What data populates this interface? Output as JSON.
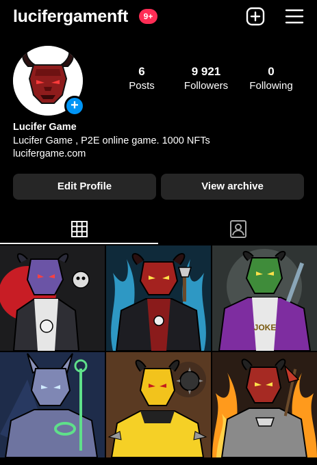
{
  "header": {
    "username": "lucifergamenft",
    "notification_badge": "9+",
    "add_icon": "plus-square-icon",
    "menu_icon": "hamburger-menu-icon"
  },
  "profile": {
    "avatar_icon": "add-story-plus-icon",
    "stats": [
      {
        "value": "6",
        "label": "Posts"
      },
      {
        "value": "9 921",
        "label": "Followers"
      },
      {
        "value": "0",
        "label": "Following"
      }
    ],
    "name": "Lucifer Game",
    "bio": "Lucifer Game , P2E online game. 1000 NFTs",
    "link": "lucifergame.com"
  },
  "actions": {
    "edit_profile": "Edit Profile",
    "view_archive": "View archive"
  },
  "tabs": [
    {
      "icon": "grid-icon",
      "active": true
    },
    {
      "icon": "tagged-person-icon",
      "active": false
    }
  ],
  "posts": [
    {
      "alt": "purple demon with skull"
    },
    {
      "alt": "red demon with blue flames and axe"
    },
    {
      "alt": "green demon in purple jacket"
    },
    {
      "alt": "blue armored demon"
    },
    {
      "alt": "yellow demon with spiked mace"
    },
    {
      "alt": "red demon with fire"
    }
  ],
  "colors": {
    "background": "#000000",
    "button": "#262626",
    "badge": "#ff2d55",
    "accent_blue": "#0095f6"
  }
}
